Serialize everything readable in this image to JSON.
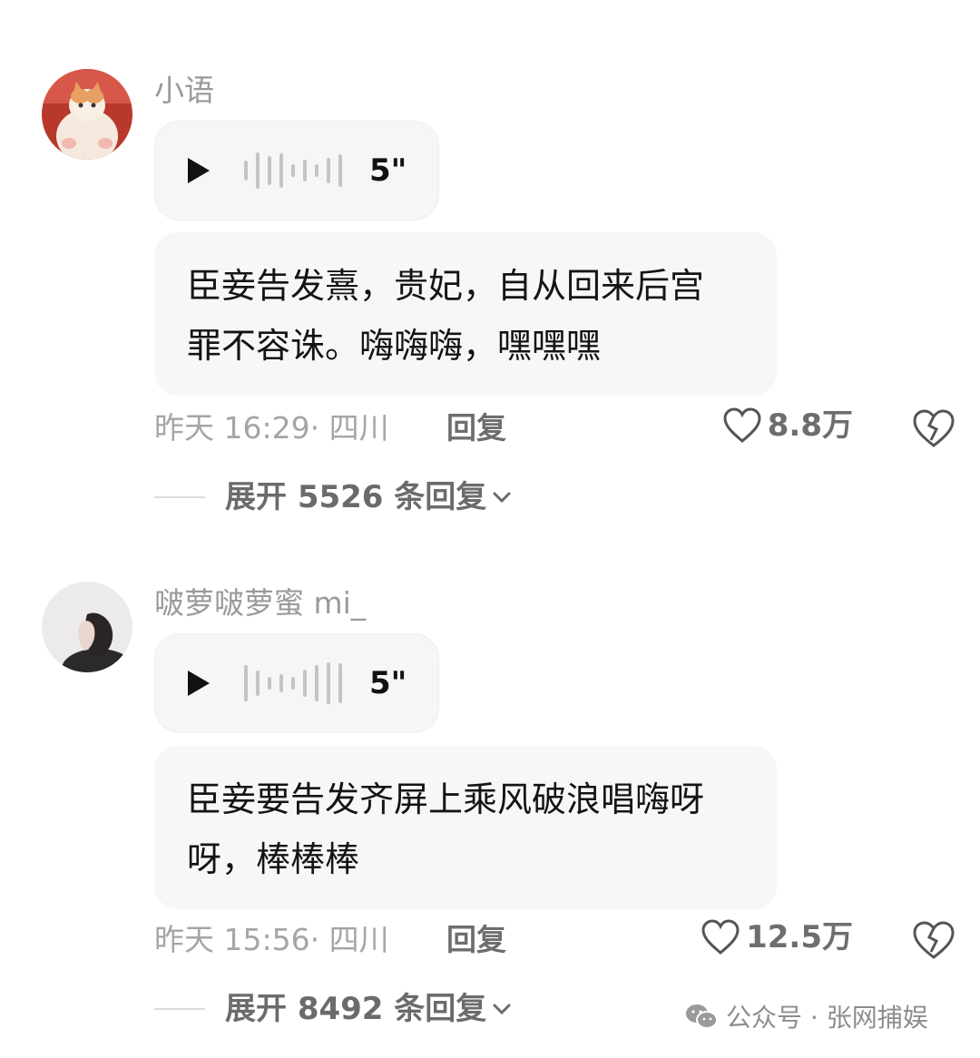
{
  "comments": [
    {
      "username": "小语",
      "avatar_icon": "cat-avatar",
      "voice_duration": "5\"",
      "transcript_line1": "臣妾告发熹，贵妃，自从回来后宫",
      "transcript_line2": "罪不容诛。嗨嗨嗨，嘿嘿嘿",
      "time_location": "昨天 16:29· 四川",
      "reply_label": "回复",
      "likes": "8.8万",
      "expand_label": "展开 5526 条回复"
    },
    {
      "username": "啵萝啵萝蜜 mi_",
      "avatar_icon": "girl-avatar",
      "voice_duration": "5\"",
      "transcript_line1": "臣妾要告发齐屏上乘风破浪唱嗨呀",
      "transcript_line2": "呀，棒棒棒",
      "time_location": "昨天 15:56· 四川",
      "reply_label": "回复",
      "likes": "12.5万",
      "expand_label": "展开 8492 条回复"
    }
  ],
  "watermark": {
    "icon": "wechat-icon",
    "text": "公众号 · 张网捕娱"
  }
}
